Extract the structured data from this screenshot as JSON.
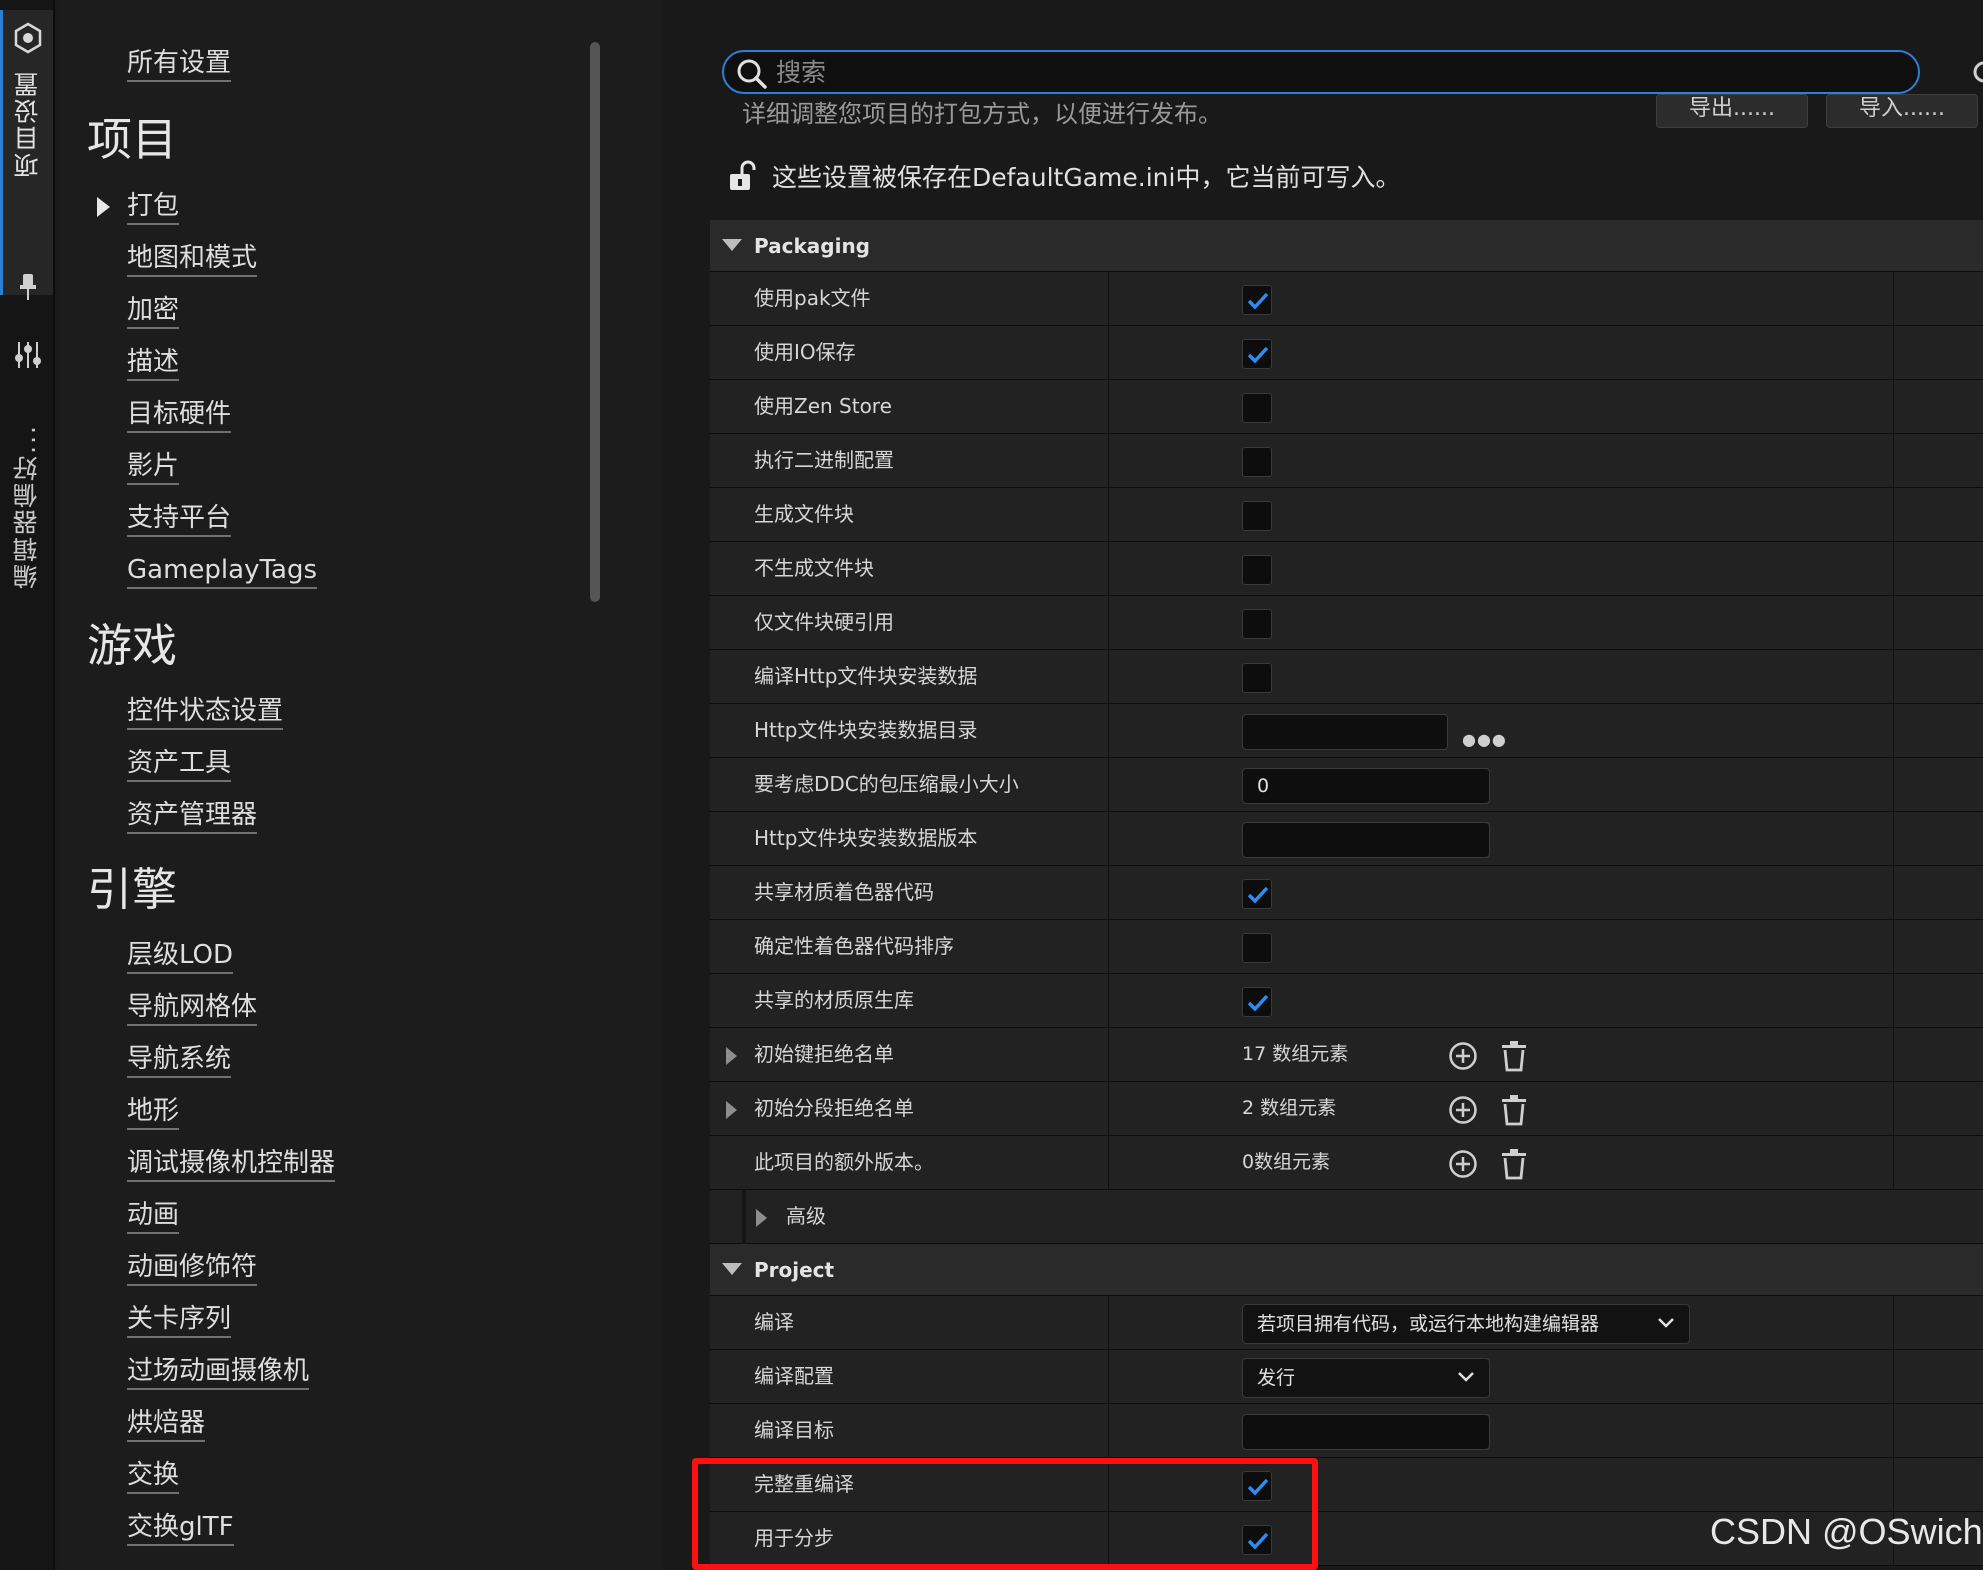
{
  "tabstrip": {
    "project_tab": "项目设置",
    "editor_tab": "编辑器偏好..."
  },
  "nav": {
    "all_settings": "所有设置",
    "sections": [
      {
        "heading": "项目",
        "items": [
          "打包",
          "地图和模式",
          "加密",
          "描述",
          "目标硬件",
          "影片",
          "支持平台",
          "GameplayTags"
        ]
      },
      {
        "heading": "游戏",
        "items": [
          "控件状态设置",
          "资产工具",
          "资产管理器"
        ]
      },
      {
        "heading": "引擎",
        "items": [
          "层级LOD",
          "导航网格体",
          "导航系统",
          "地形",
          "调试摄像机控制器",
          "动画",
          "动画修饰符",
          "关卡序列",
          "过场动画摄像机",
          "烘焙器",
          "交换",
          "交换glTF"
        ]
      }
    ]
  },
  "main": {
    "search_placeholder": "搜索",
    "description": "详细调整您项目的打包方式，以便进行发布。",
    "export_button": "导出......",
    "import_button": "导入......",
    "save_note": "这些设置被保存在DefaultGame.ini中，它当前可写入。"
  },
  "packaging": {
    "category": "Packaging",
    "rows": [
      {
        "label": "使用pak文件",
        "type": "checkbox",
        "checked": true
      },
      {
        "label": "使用IO保存",
        "type": "checkbox",
        "checked": true
      },
      {
        "label": "使用Zen Store",
        "type": "checkbox",
        "checked": false
      },
      {
        "label": "执行二进制配置",
        "type": "checkbox",
        "checked": false
      },
      {
        "label": "生成文件块",
        "type": "checkbox",
        "checked": false
      },
      {
        "label": "不生成文件块",
        "type": "checkbox",
        "checked": false
      },
      {
        "label": "仅文件块硬引用",
        "type": "checkbox",
        "checked": false
      },
      {
        "label": "编译Http文件块安装数据",
        "type": "checkbox",
        "checked": false
      },
      {
        "label": "Http文件块安装数据目录",
        "type": "path",
        "value": ""
      },
      {
        "label": "要考虑DDC的包压缩最小大小",
        "type": "text",
        "value": "0"
      },
      {
        "label": "Http文件块安装数据版本",
        "type": "text",
        "value": ""
      },
      {
        "label": "共享材质着色器代码",
        "type": "checkbox",
        "checked": true
      },
      {
        "label": "确定性着色器代码排序",
        "type": "checkbox",
        "checked": false
      },
      {
        "label": "共享的材质原生库",
        "type": "checkbox",
        "checked": true
      },
      {
        "label": "初始键拒绝名单",
        "type": "array",
        "value": "17 数组元素",
        "expandable": true
      },
      {
        "label": "初始分段拒绝名单",
        "type": "array",
        "value": "2 数组元素",
        "expandable": true
      },
      {
        "label": "此项目的额外版本。",
        "type": "array",
        "value": "0数组元素",
        "expandable": false
      }
    ],
    "advanced_label": "高级"
  },
  "project": {
    "category": "Project",
    "rows": [
      {
        "label": "编译",
        "type": "dropdown",
        "value": "若项目拥有代码，或运行本地构建编辑器"
      },
      {
        "label": "编译配置",
        "type": "dropdown",
        "value": "发行"
      },
      {
        "label": "编译目标",
        "type": "text",
        "value": ""
      },
      {
        "label": "完整重编译",
        "type": "checkbox",
        "checked": true
      },
      {
        "label": "用于分步",
        "type": "checkbox",
        "checked": true
      }
    ]
  },
  "watermark": "CSDN @OSwich",
  "colors": {
    "accent": "#2d7fd6",
    "checkmark": "#2e8cf0",
    "highlight": "#ff1010",
    "panel": "#222222",
    "category": "#2a2a2a"
  }
}
